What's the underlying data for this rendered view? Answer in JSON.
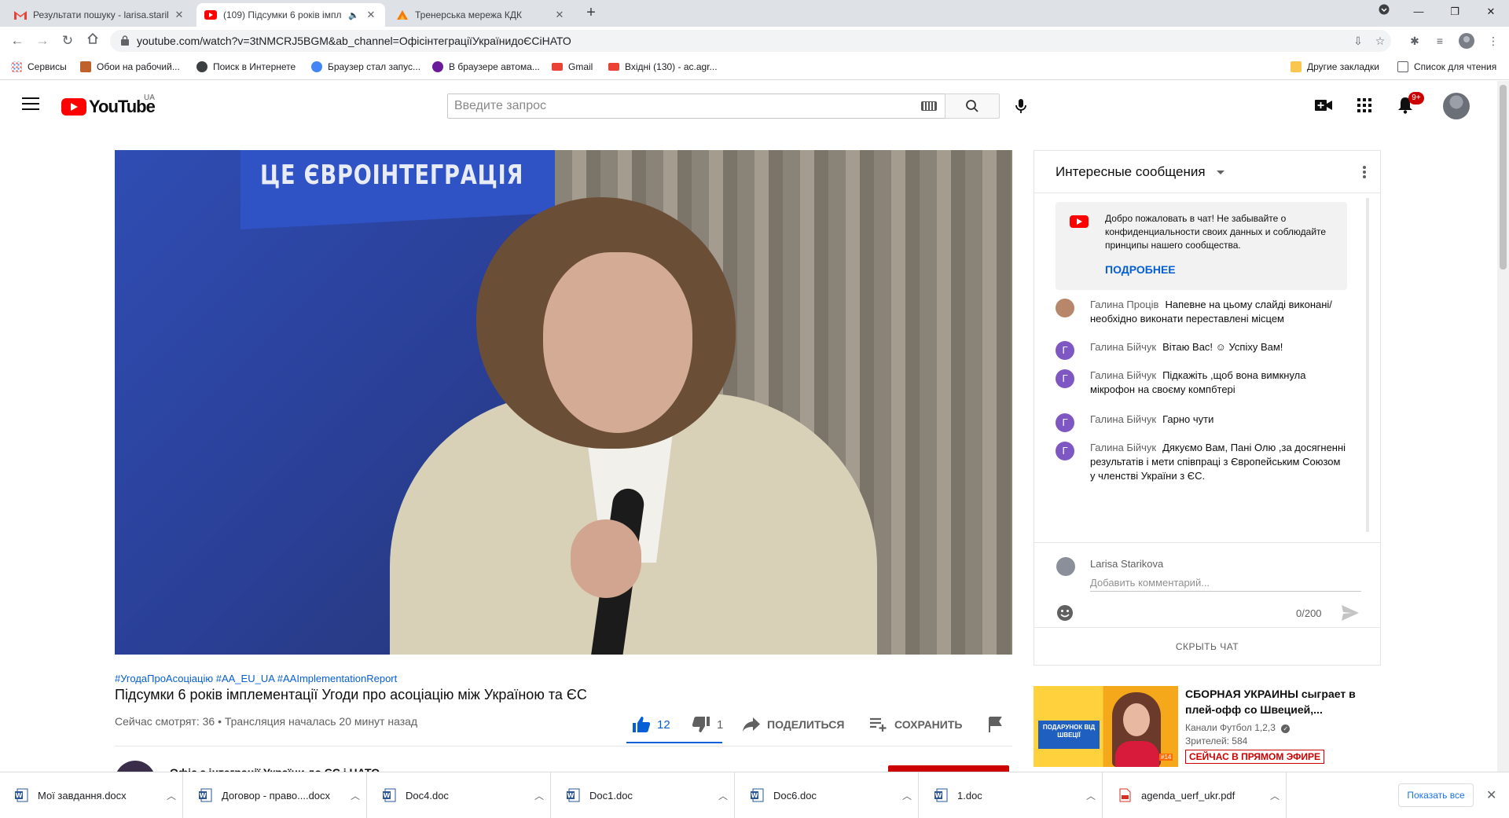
{
  "browser": {
    "tabs": [
      {
        "title": "Результати пошуку - larisa.starik",
        "icon": "gmail-icon"
      },
      {
        "title": "(109) Підсумки 6 років імпл",
        "icon": "youtube-icon",
        "audio": true
      },
      {
        "title": "Тренерська мережа КДК",
        "icon": "kdk-icon"
      }
    ],
    "url": "youtube.com/watch?v=3tNMCRJ5BGM&ab_channel=ОфісінтеграціїУкраїнидоЄСіНАТО",
    "bookmarks": [
      {
        "label": "Сервисы",
        "color": "#ea4335"
      },
      {
        "label": "Обои на рабочий...",
        "color": "#c0602b"
      },
      {
        "label": "Поиск в Интернете",
        "color": "#3c4043"
      },
      {
        "label": "Браузер стал запус...",
        "color": "#4285f4"
      },
      {
        "label": "В браузере автома...",
        "color": "#6a1b9a"
      },
      {
        "label": "Gmail",
        "color": "#ea4335"
      },
      {
        "label": "Вхідні (130) - ac.agr...",
        "color": "#ea4335"
      }
    ],
    "other_bookmarks": "Другие закладки",
    "reading_list": "Список для чтения"
  },
  "youtube": {
    "logo_text": "YouTube",
    "country": "UA",
    "search_placeholder": "Введите запрос",
    "notification_count": "9+",
    "video": {
      "banner_text": "ЦЕ ЄВРОІНТЕГРАЦІЯ",
      "hashtags": "#УгодаПроАсоціацію #AA_EU_UA #AAImplementationReport",
      "title": "Підсумки 6 років імплементації Угоди про асоціацію між Україною та ЄС",
      "view_info": "Сейчас смотрят: 36 • Трансляция началась 20 минут назад",
      "likes": "12",
      "dislikes": "1",
      "share_label": "ПОДЕЛИТЬСЯ",
      "save_label": "СОХРАНИТЬ",
      "channel_name": "Офіс з інтеграції України до ЄС і НАТО"
    },
    "chat": {
      "title": "Интересные сообщения",
      "welcome_text": "Добро пожаловать в чат! Не забывайте о конфиденциальности своих данных и соблюдайте принципы нашего сообщества.",
      "welcome_more": "ПОДРОБНЕЕ",
      "messages": [
        {
          "author": "Галина Проців",
          "text": "Напевне на цьому слайді виконані/ необхідно виконати переставлені місцем",
          "initial": "",
          "avatar_color": "#b8866a"
        },
        {
          "author": "Галина Бійчук",
          "text": "Вітаю Вас! ☺ Успіху Вам!",
          "initial": "Г",
          "avatar_color": "#7e57c2"
        },
        {
          "author": "Галина Бійчук",
          "text": "Підкажіть ,щоб вона вимкнула мікрофон на своєму компбтері",
          "initial": "Г",
          "avatar_color": "#7e57c2"
        },
        {
          "author": "Галина Бійчук",
          "text": "Гарно чути",
          "initial": "Г",
          "avatar_color": "#7e57c2"
        },
        {
          "author": "Галина Бійчук",
          "text": "Дякуємо Вам, Пані Олю ,за досягненні результатів і мети співпраці з Європейським Союзом у членстві України з ЄС.",
          "initial": "Г",
          "avatar_color": "#7e57c2"
        }
      ],
      "user_name": "Larisa Starikova",
      "input_placeholder": "Добавить комментарий...",
      "counter": "0/200",
      "hide_label": "СКРЫТЬ ЧАТ"
    },
    "recommendation": {
      "title": "СБОРНАЯ УКРАИНЫ сыграет в плей-офф со Швецией,...",
      "channel": "Канали Футбол 1,2,3",
      "views": "Зрителей: 584",
      "live_badge": "СЕЙЧАС В ПРЯМОМ ЭФИРЕ",
      "thumb_text": "ПОДАРУНОК ВІД ШВЕЦІЇ",
      "thumb_badge": "#14"
    }
  },
  "downloads": {
    "items": [
      {
        "name": "Мої завдання.docx",
        "type": "word"
      },
      {
        "name": "Договор - право....docx",
        "type": "word"
      },
      {
        "name": "Doc4.doc",
        "type": "word"
      },
      {
        "name": "Doc1.doc",
        "type": "word"
      },
      {
        "name": "Doc6.doc",
        "type": "word"
      },
      {
        "name": "1.doc",
        "type": "word"
      },
      {
        "name": "agenda_uerf_ukr.pdf",
        "type": "pdf"
      }
    ],
    "show_all": "Показать все"
  }
}
